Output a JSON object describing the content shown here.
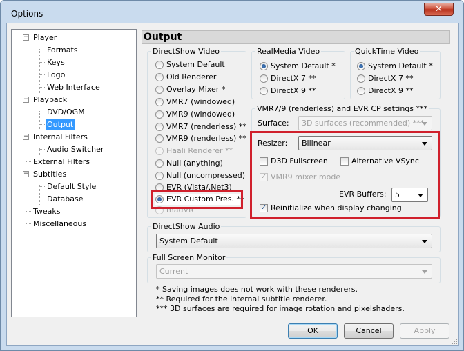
{
  "window": {
    "title": "Options",
    "close": "✕"
  },
  "tree": {
    "items": [
      "Player",
      "Formats",
      "Keys",
      "Logo",
      "Web Interface",
      "Playback",
      "DVD/OGM",
      "Output",
      "Internal Filters",
      "Audio Switcher",
      "External Filters",
      "Subtitles",
      "Default Style",
      "Database",
      "Tweaks",
      "Miscellaneous"
    ],
    "expander": "−"
  },
  "header": {
    "title": "Output"
  },
  "directshow_video": {
    "label": "DirectShow Video",
    "options": [
      "System Default",
      "Old Renderer",
      "Overlay Mixer *",
      "VMR7 (windowed)",
      "VMR9 (windowed)",
      "VMR7 (renderless) **",
      "VMR9 (renderless) **",
      "Haali Renderer **",
      "Null (anything)",
      "Null (uncompressed)",
      "EVR (Vista/.Net3)",
      "EVR Custom Pres. **",
      "madVR"
    ],
    "selected": "EVR Custom Pres. **"
  },
  "realmedia_video": {
    "label": "RealMedia Video",
    "options": [
      "System Default *",
      "DirectX 7 **",
      "DirectX 9 **"
    ],
    "selected": "System Default *"
  },
  "quicktime_video": {
    "label": "QuickTime Video",
    "options": [
      "System Default *",
      "DirectX 7 **",
      "DirectX 9 **"
    ],
    "selected": "System Default *"
  },
  "vmr_settings": {
    "label": "VMR7/9 (renderless) and EVR CP settings ***",
    "surface_label": "Surface:",
    "surface_value": "3D surfaces (recommended) ***",
    "resizer_label": "Resizer:",
    "resizer_value": "Bilinear",
    "d3d_fullscreen": "D3D Fullscreen",
    "alt_vsync": "Alternative VSync",
    "vmr9_mixer": "VMR9 mixer mode",
    "evr_buffers_label": "EVR Buffers:",
    "evr_buffers_value": "5",
    "reinit": "Reinitialize when display changing",
    "checkmark": "✓"
  },
  "directshow_audio": {
    "label": "DirectShow Audio",
    "value": "System Default"
  },
  "fullscreen_monitor": {
    "label": "Full Screen Monitor",
    "value": "Current"
  },
  "notes": [
    "* Saving images does not work with these renderers.",
    "** Required for the internal subtitle renderer.",
    "*** 3D surfaces are required for image rotation and pixelshaders."
  ],
  "buttons": {
    "ok": "OK",
    "cancel": "Cancel",
    "apply": "Apply"
  },
  "colors": {
    "highlight": "#d0202c",
    "selection": "#3399ff"
  }
}
